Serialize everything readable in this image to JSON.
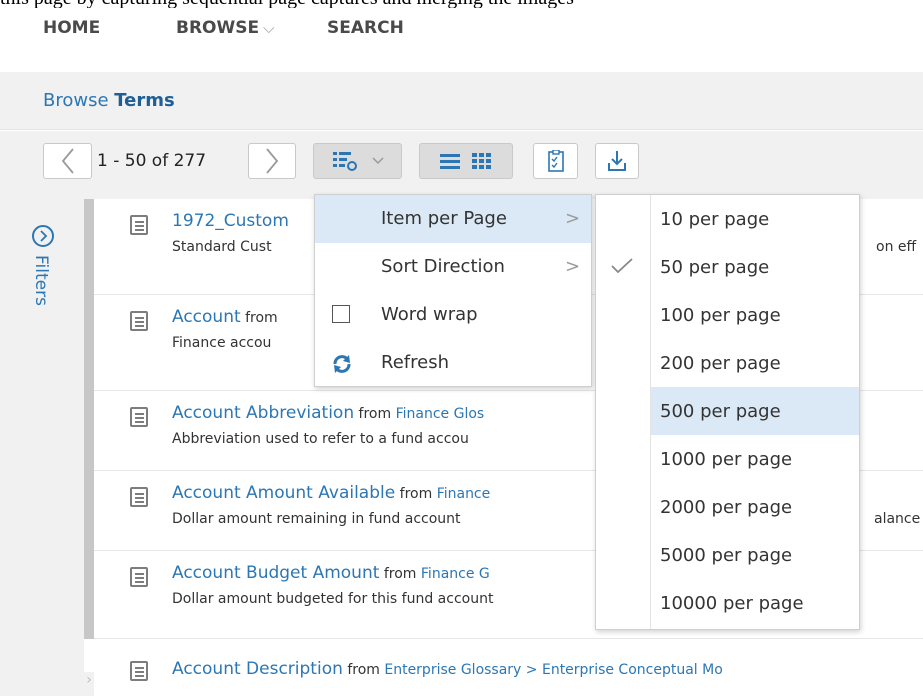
{
  "cut_text": "this page by capturing sequential page captures and merging the images",
  "nav": {
    "home": "HOME",
    "browse": "BROWSE",
    "browse_chevron": "⌵",
    "search": "SEARCH"
  },
  "page": {
    "title_prefix": "Browse",
    "title_strong": "Terms"
  },
  "toolbar": {
    "pager_text": "1 - 50 of 277"
  },
  "sidebar": {
    "filters_label": "Filters"
  },
  "rows": [
    {
      "name": "1972_Custom",
      "from": "",
      "source": "",
      "desc": "Standard Cust",
      "trail": "on eff"
    },
    {
      "name": "Account",
      "from": " from",
      "source": "",
      "desc": "Finance accou",
      "trail": ""
    },
    {
      "name": "Account Abbreviation",
      "from": " from ",
      "source": "Finance Glos",
      "desc": "Abbreviation used to refer to a fund accou",
      "trail": ""
    },
    {
      "name": "Account Amount Available",
      "from": " from ",
      "source": "Finance",
      "desc": "Dollar amount remaining in fund account",
      "trail": "alance"
    },
    {
      "name": "Account Budget Amount",
      "from": " from ",
      "source": "Finance G",
      "desc": "Dollar amount budgeted for this fund account",
      "trail": ""
    },
    {
      "name": "Account Description",
      "from": " from ",
      "source": "Enterprise Glossary > Enterprise Conceptual Mo",
      "desc": "",
      "trail": ""
    }
  ],
  "menu": {
    "items": [
      {
        "label": "Item per Page",
        "arrow": ">"
      },
      {
        "label": "Sort Direction",
        "arrow": ">"
      },
      {
        "label": "Word wrap",
        "checked": false
      },
      {
        "label": "Refresh"
      }
    ],
    "highlighted": "Item per Page"
  },
  "submenu": {
    "items": [
      "10 per page",
      "50 per page",
      "100 per page",
      "200 per page",
      "500 per page",
      "1000 per page",
      "2000 per page",
      "5000 per page",
      "10000 per page"
    ],
    "selected": "50 per page",
    "highlighted": "500 per page"
  },
  "colors": {
    "link": "#2c77b3",
    "highlight": "#dae9f5",
    "toolbar_bg": "#f1f1f1"
  }
}
